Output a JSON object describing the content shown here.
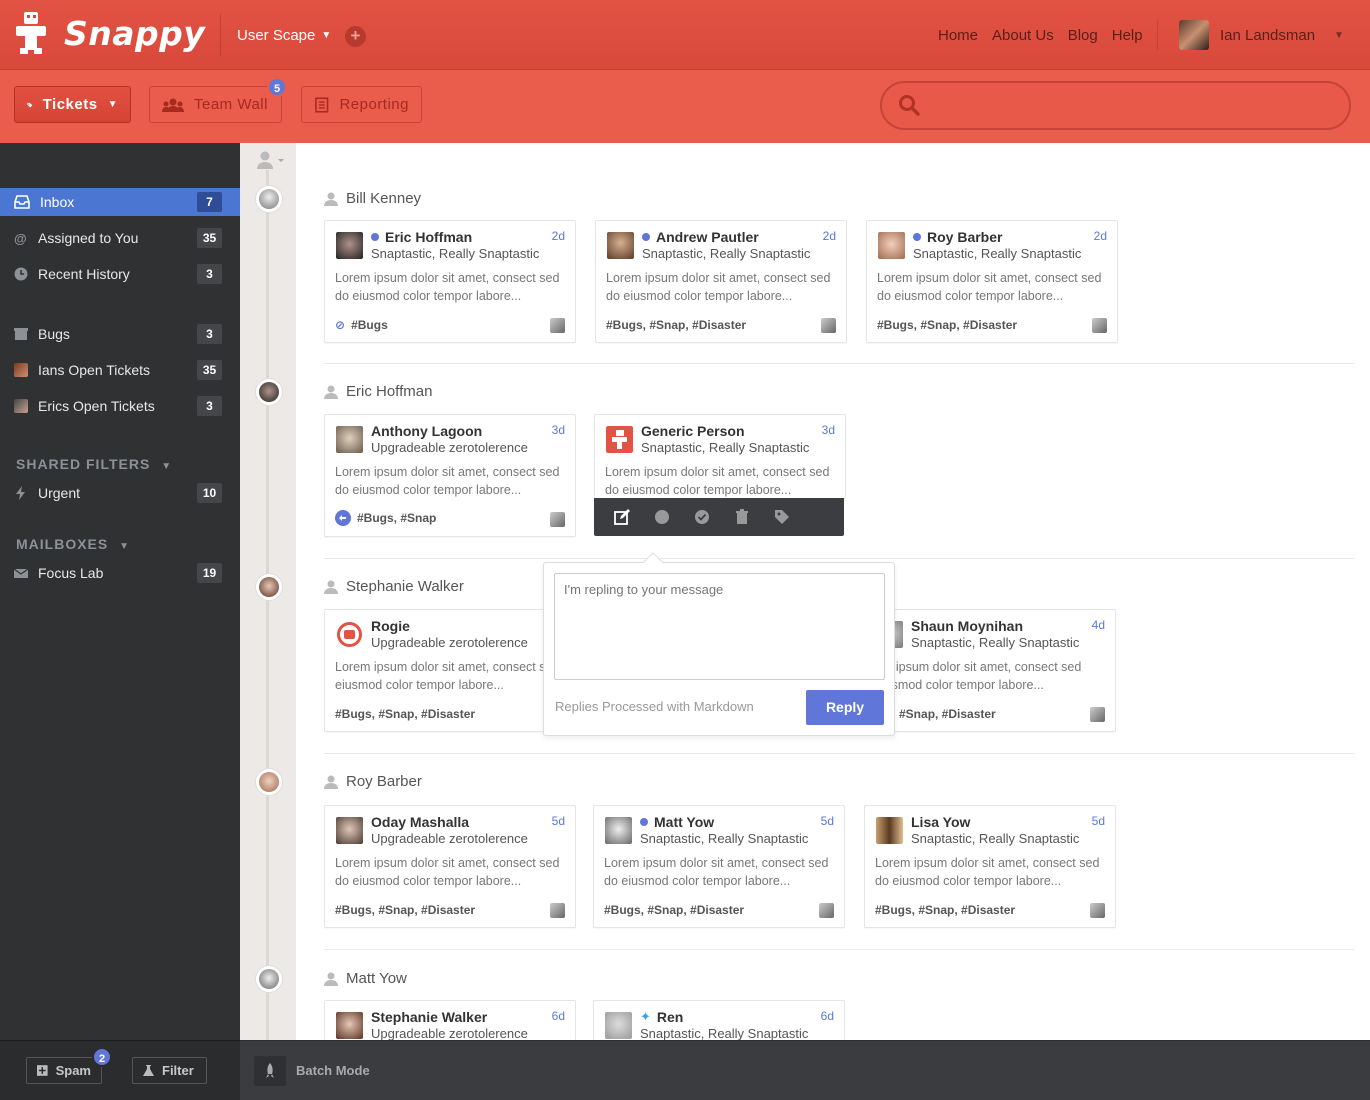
{
  "app": {
    "brand": "Snappy",
    "workspace": "User Scape",
    "accent": "#ea5c4b",
    "link_blue": "#6076d8"
  },
  "nav": {
    "home": "Home",
    "about": "About Us",
    "blog": "Blog",
    "help": "Help",
    "user": "Ian Landsman"
  },
  "toolbar": {
    "tickets": "Tickets",
    "team_wall": "Team Wall",
    "team_wall_badge": "5",
    "reporting": "Reporting",
    "search_placeholder": ""
  },
  "sidebar": {
    "items": [
      {
        "label": "Inbox",
        "count": "7",
        "icon": "inbox-icon"
      },
      {
        "label": "Assigned to You",
        "count": "35",
        "icon": "at-icon"
      },
      {
        "label": "Recent History",
        "count": "3",
        "icon": "clock-icon"
      },
      {
        "label": "Bugs",
        "count": "3",
        "icon": "box-icon"
      },
      {
        "label": "Ians Open Tickets",
        "count": "35",
        "icon": "avatar"
      },
      {
        "label": "Erics Open Tickets",
        "count": "3",
        "icon": "avatar"
      }
    ],
    "shared_filters": {
      "heading": "SHARED FILTERS",
      "items": [
        {
          "label": "Urgent",
          "count": "10",
          "icon": "bolt-icon"
        }
      ]
    },
    "mailboxes": {
      "heading": "MAILBOXES",
      "items": [
        {
          "label": "Focus Lab",
          "count": "19",
          "icon": "mail-icon"
        }
      ]
    }
  },
  "footer": {
    "spam": "Spam",
    "spam_badge": "2",
    "filter": "Filter",
    "batch": "Batch Mode"
  },
  "groups": [
    {
      "title": "Bill Kenney",
      "cards": [
        {
          "name": "Eric Hoffman",
          "sub": "Snaptastic, Really Snaptastic",
          "age": "2d",
          "dot": true,
          "body": "Lorem ipsum dolor sit amet, consect sed do eiusmod color tempor labore...",
          "tags": "#Bugs"
        },
        {
          "name": "Andrew Pautler",
          "sub": "Snaptastic, Really Snaptastic",
          "age": "2d",
          "dot": true,
          "body": "Lorem ipsum dolor sit amet, consect sed do eiusmod color tempor labore...",
          "tags": "#Bugs, #Snap, #Disaster"
        },
        {
          "name": "Roy Barber",
          "sub": "Snaptastic, Really Snaptastic",
          "age": "2d",
          "dot": true,
          "body": "Lorem ipsum dolor sit amet, consect sed do eiusmod color tempor labore...",
          "tags": "#Bugs, #Snap, #Disaster"
        }
      ]
    },
    {
      "title": "Eric Hoffman",
      "cards": [
        {
          "name": "Anthony Lagoon",
          "sub": "Upgradeable zerotolerence",
          "age": "3d",
          "dot": false,
          "body": "Lorem ipsum dolor sit amet, consect sed do eiusmod color tempor labore...",
          "tags": "#Bugs, #Snap"
        },
        {
          "name": "Generic Person",
          "sub": "Snaptastic, Really Snaptastic",
          "age": "3d",
          "dot": false,
          "body": "Lorem ipsum dolor sit amet, consect sed do eiusmod color tempor labore...",
          "tags": ""
        }
      ]
    },
    {
      "title": "Stephanie Walker",
      "cards": [
        {
          "name": "Rogie",
          "sub": "Upgradeable zerotolerence",
          "age": "",
          "dot": false,
          "body": "Lorem ipsum dolor sit amet, consect s do eiusmod color tempor labore...",
          "tags": "#Bugs, #Snap, #Disaster"
        },
        {
          "name": "Shaun Moynihan",
          "sub": "Snaptastic, Really Snaptastic",
          "age": "4d",
          "dot": false,
          "body": "em ipsum dolor sit amet, consect sed eiusmod color tempor labore...",
          "tags": "ıgs, #Snap, #Disaster"
        }
      ]
    },
    {
      "title": "Roy Barber",
      "cards": [
        {
          "name": "Oday Mashalla",
          "sub": "Upgradeable zerotolerence",
          "age": "5d",
          "dot": false,
          "body": "Lorem ipsum dolor sit amet, consect sed do eiusmod color tempor labore...",
          "tags": "#Bugs, #Snap, #Disaster"
        },
        {
          "name": "Matt Yow",
          "sub": "Snaptastic, Really Snaptastic",
          "age": "5d",
          "dot": true,
          "body": "Lorem ipsum dolor sit amet, consect sed do eiusmod color tempor labore...",
          "tags": "#Bugs, #Snap, #Disaster"
        },
        {
          "name": "Lisa Yow",
          "sub": "Snaptastic, Really Snaptastic",
          "age": "5d",
          "dot": false,
          "body": "Lorem ipsum dolor sit amet, consect sed do eiusmod color tempor labore...",
          "tags": "#Bugs, #Snap, #Disaster"
        }
      ]
    },
    {
      "title": "Matt Yow",
      "cards": [
        {
          "name": "Stephanie Walker",
          "sub": "Upgradeable zerotolerence",
          "age": "6d",
          "dot": false
        },
        {
          "name": "Ren",
          "sub": "Snaptastic, Really Snaptastic",
          "age": "6d",
          "dot": false
        }
      ]
    }
  ],
  "reply_popover": {
    "placeholder": "I'm repling to your message",
    "note": "Replies Processed with Markdown",
    "button": "Reply"
  }
}
